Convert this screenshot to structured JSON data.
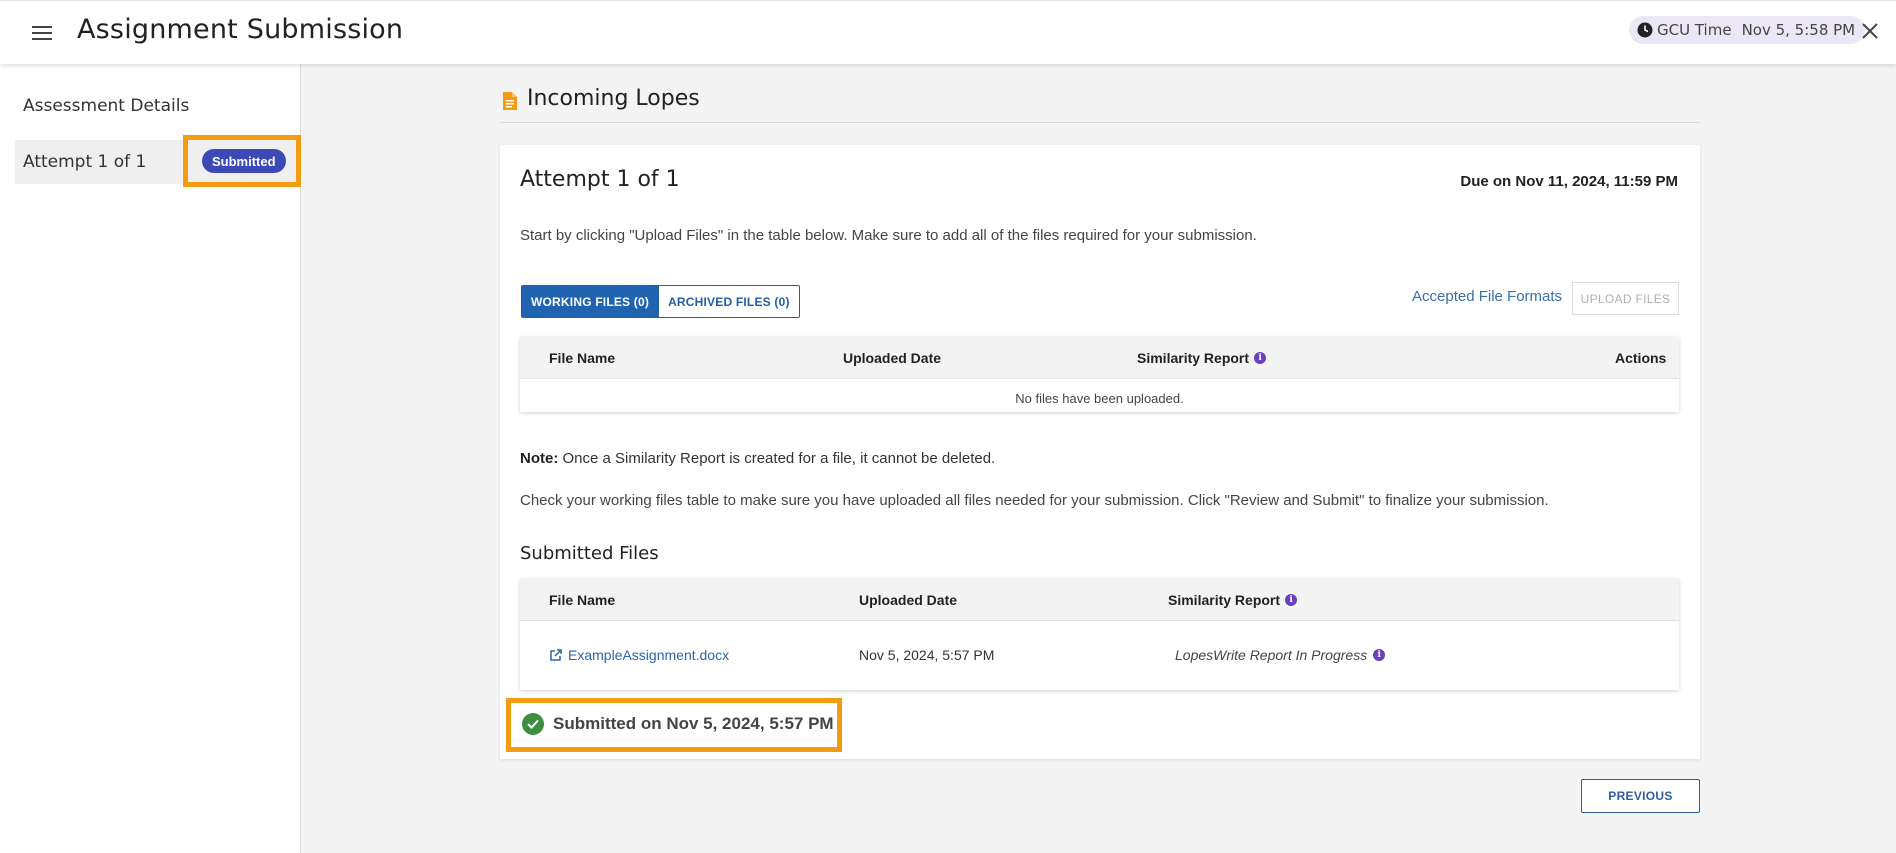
{
  "header": {
    "title": "Assignment Submission",
    "gcu_time_label": "GCU Time",
    "gcu_time_value": "Nov 5, 5:58 PM",
    "icons": [
      "menu-icon",
      "clock-icon",
      "close-icon"
    ]
  },
  "sidebar": {
    "heading": "Assessment Details",
    "attempt_label": "Attempt 1 of 1",
    "badge": "Submitted",
    "badge_color": "#3d49b5"
  },
  "main": {
    "section_title": "Incoming Lopes",
    "attempt_title": "Attempt 1 of 1",
    "due": "Due on Nov 11, 2024, 11:59 PM",
    "instructions": "Start by clicking \"Upload Files\" in the table below. Make sure to add all of the files required for your submission.",
    "tabs": [
      {
        "label": "WORKING FILES (0)",
        "active": true
      },
      {
        "label": "ARCHIVED FILES (0)",
        "active": false
      }
    ],
    "accepted_link": "Accepted File Formats",
    "upload_button": "UPLOAD FILES",
    "working_table": {
      "headers": [
        "File Name",
        "Uploaded Date",
        "Similarity Report",
        "Actions"
      ],
      "empty_message": "No files have been uploaded."
    },
    "note_label": "Note:",
    "note_text": " Once a Similarity Report is created for a file, it cannot be deleted.",
    "check_text": "Check your working files table to make sure you have uploaded all files needed for your submission. Click \"Review and Submit\" to finalize your submission.",
    "submitted_title": "Submitted Files",
    "submitted_table": {
      "headers": [
        "File Name",
        "Uploaded Date",
        "Similarity Report"
      ],
      "rows": [
        {
          "file": "ExampleAssignment.docx",
          "date": "Nov 5, 2024, 5:57 PM",
          "report": "LopesWrite Report In Progress"
        }
      ]
    },
    "submitted_status": "Submitted on Nov 5, 2024, 5:57 PM",
    "previous_button": "PREVIOUS",
    "accent_color": "#1f63b1",
    "highlight_color": "#f39c12",
    "success_color": "#3e8e41"
  }
}
